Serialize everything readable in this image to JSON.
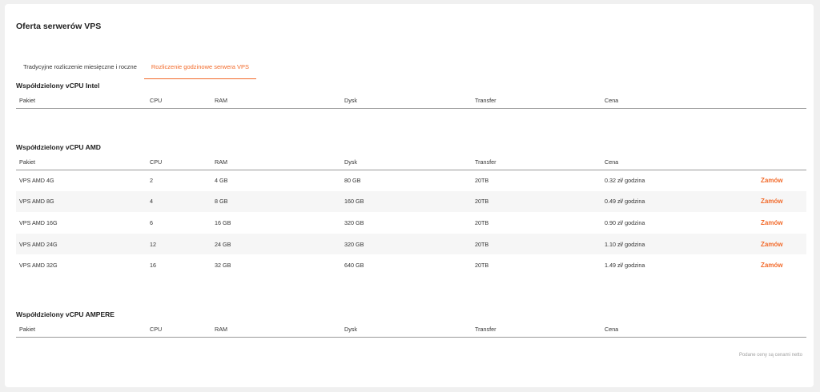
{
  "page": {
    "title": "Oferta serwerów VPS"
  },
  "tabs": [
    {
      "label": "Tradycyjne rozliczenie miesięczne i roczne",
      "active": false
    },
    {
      "label": "Rozliczenie godzinowe serwera VPS",
      "active": true
    }
  ],
  "columns": [
    "Pakiet",
    "CPU",
    "RAM",
    "Dysk",
    "Transfer",
    "Cena"
  ],
  "sections": [
    {
      "title": "Współdzielony vCPU Intel",
      "rows": []
    },
    {
      "title": "Współdzielony vCPU AMD",
      "rows": [
        {
          "pakiet": "VPS AMD 4G",
          "cpu": "2",
          "ram": "4 GB",
          "dysk": "80 GB",
          "transfer": "20TB",
          "cena": "0.32 zł/ godzina",
          "action": "Zamów"
        },
        {
          "pakiet": "VPS AMD 8G",
          "cpu": "4",
          "ram": "8 GB",
          "dysk": "160 GB",
          "transfer": "20TB",
          "cena": "0.49 zł/ godzina",
          "action": "Zamów"
        },
        {
          "pakiet": "VPS AMD 16G",
          "cpu": "6",
          "ram": "16 GB",
          "dysk": "320 GB",
          "transfer": "20TB",
          "cena": "0.90 zł/ godzina",
          "action": "Zamów"
        },
        {
          "pakiet": "VPS AMD 24G",
          "cpu": "12",
          "ram": "24 GB",
          "dysk": "320 GB",
          "transfer": "20TB",
          "cena": "1.10 zł/ godzina",
          "action": "Zamów"
        },
        {
          "pakiet": "VPS AMD 32G",
          "cpu": "16",
          "ram": "32 GB",
          "dysk": "640 GB",
          "transfer": "20TB",
          "cena": "1.49 zł/ godzina",
          "action": "Zamów"
        }
      ]
    },
    {
      "title": "Współdzielony vCPU AMPERE",
      "rows": []
    }
  ],
  "footnote": "Podane ceny są cenami netto",
  "colors": {
    "accent": "#f26a2a",
    "background": "#f0f0f0",
    "card": "#ffffff"
  }
}
